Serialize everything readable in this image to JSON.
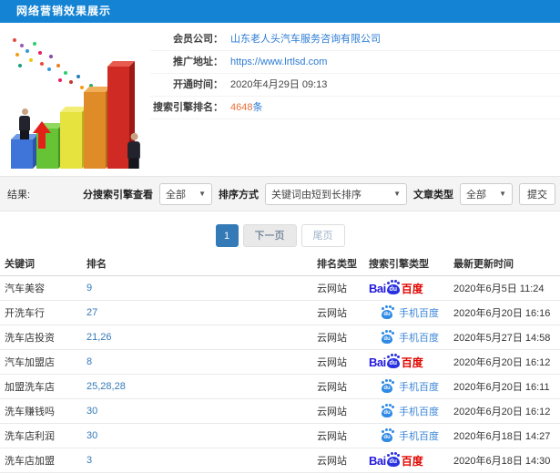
{
  "colors": {
    "topbar_bg": "#1583d3",
    "link_blue": "#2b7bd3",
    "rank_blue": "#337ab7",
    "count_orange": "#e8703a",
    "baidu_blue": "#2319dc",
    "baidu_red": "#e10601",
    "mobile_baidu_blue": "#3d87d6",
    "filter_bar_bg": "#f4f4f4"
  },
  "header": {
    "title": "网络营销效果展示"
  },
  "info": {
    "rows": [
      {
        "label": "会员公司：",
        "value": "山东老人头汽车服务咨询有限公司",
        "type": "link"
      },
      {
        "label": "推广地址：",
        "value": "https://www.lrtlsd.com",
        "type": "link"
      },
      {
        "label": "开通时间：",
        "value": "2020年4月29日 09:13",
        "type": "text"
      },
      {
        "label": "搜索引擎排名：",
        "value": "4648",
        "suffix": "条",
        "type": "count"
      }
    ]
  },
  "filters": {
    "result_label": "结果:",
    "engine_label": "分搜索引擎查看",
    "engine_value": "全部",
    "sort_label": "排序方式",
    "sort_value": "关键词由短到长排序",
    "article_label": "文章类型",
    "article_value": "全部",
    "submit_label": "提交",
    "caret": "▼"
  },
  "pagination": {
    "current": "1",
    "next": "下一页",
    "last": "尾页"
  },
  "table": {
    "headers": [
      "关键词",
      "排名",
      "排名类型",
      "搜索引擎类型",
      "最新更新时间"
    ],
    "rows": [
      {
        "keyword": "汽车美容",
        "rank": "9",
        "rank_type": "云网站",
        "engine": "baidu",
        "time": "2020年6月5日 11:24"
      },
      {
        "keyword": "开洗车行",
        "rank": "27",
        "rank_type": "云网站",
        "engine": "mobile",
        "time": "2020年6月20日 16:16"
      },
      {
        "keyword": "洗车店投资",
        "rank": "21,26",
        "rank_type": "云网站",
        "engine": "mobile",
        "time": "2020年5月27日 14:58"
      },
      {
        "keyword": "汽车加盟店",
        "rank": "8",
        "rank_type": "云网站",
        "engine": "baidu",
        "time": "2020年6月20日 16:12"
      },
      {
        "keyword": "加盟洗车店",
        "rank": "25,28,28",
        "rank_type": "云网站",
        "engine": "mobile",
        "time": "2020年6月20日 16:11"
      },
      {
        "keyword": "洗车赚钱吗",
        "rank": "30",
        "rank_type": "云网站",
        "engine": "mobile",
        "time": "2020年6月20日 16:12"
      },
      {
        "keyword": "洗车店利润",
        "rank": "30",
        "rank_type": "云网站",
        "engine": "mobile",
        "time": "2020年6月18日 14:27"
      },
      {
        "keyword": "洗车店加盟",
        "rank": "3",
        "rank_type": "云网站",
        "engine": "baidu",
        "time": "2020年6月18日 14:30"
      }
    ]
  },
  "engines": {
    "baidu": {
      "text_left": "Bai",
      "paw_text": "du",
      "text_right": "百度"
    },
    "mobile": {
      "paw_text": "du",
      "label": "手机百度"
    }
  }
}
